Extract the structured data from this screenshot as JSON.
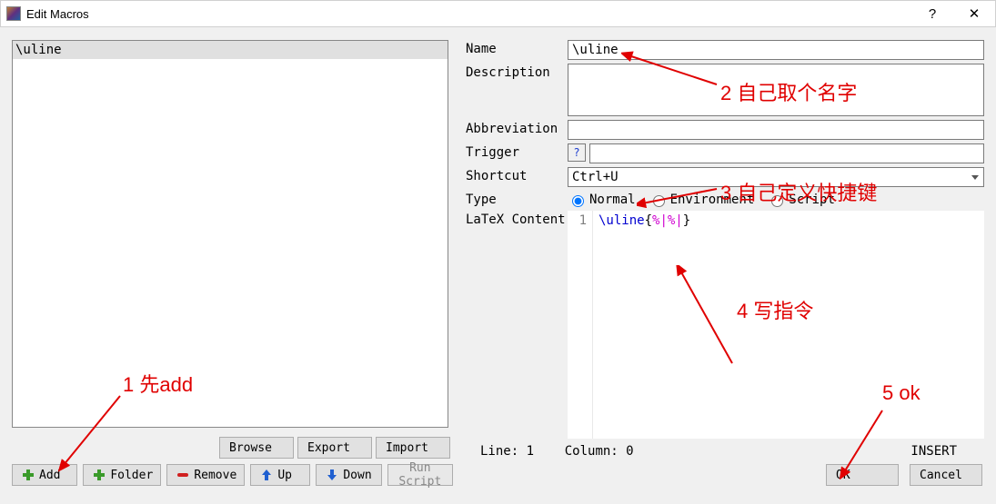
{
  "window": {
    "title": "Edit Macros",
    "help_symbol": "?",
    "close_symbol": "✕"
  },
  "macro_list": {
    "items": [
      "\\uline"
    ]
  },
  "left_buttons": {
    "browse": "Browse",
    "export": "Export",
    "import": "Import",
    "add": "Add",
    "folder": "Folder",
    "remove": "Remove",
    "up": "Up",
    "down": "Down",
    "run_script": "Run Script"
  },
  "form": {
    "name_label": "Name",
    "name_value": "\\uline",
    "description_label": "Description",
    "description_value": "",
    "abbrev_label": "Abbreviation",
    "abbrev_value": "",
    "trigger_label": "Trigger",
    "trigger_help": "?",
    "trigger_value": "",
    "shortcut_label": "Shortcut",
    "shortcut_value": "Ctrl+U",
    "type_label": "Type",
    "type_options": {
      "normal": "Normal",
      "environment": "Environment",
      "script": "Script"
    },
    "type_selected": "normal",
    "content_label": "LaTeX Content",
    "code": {
      "line_no": "1",
      "cmd": "\\uline",
      "open": "{",
      "placeholder1": "%|",
      "placeholder2": "%|",
      "close": "}"
    }
  },
  "status": {
    "line_label": "Line: ",
    "line": "1",
    "col_label": "Column: ",
    "col": "0",
    "mode": "INSERT"
  },
  "actions": {
    "ok": "OK",
    "cancel": "Cancel"
  },
  "annotations": {
    "a1": "1 先add",
    "a2": "2 自己取个名字",
    "a3": "3 自己定义快捷键",
    "a4": "4 写指令",
    "a5": "5 ok"
  }
}
